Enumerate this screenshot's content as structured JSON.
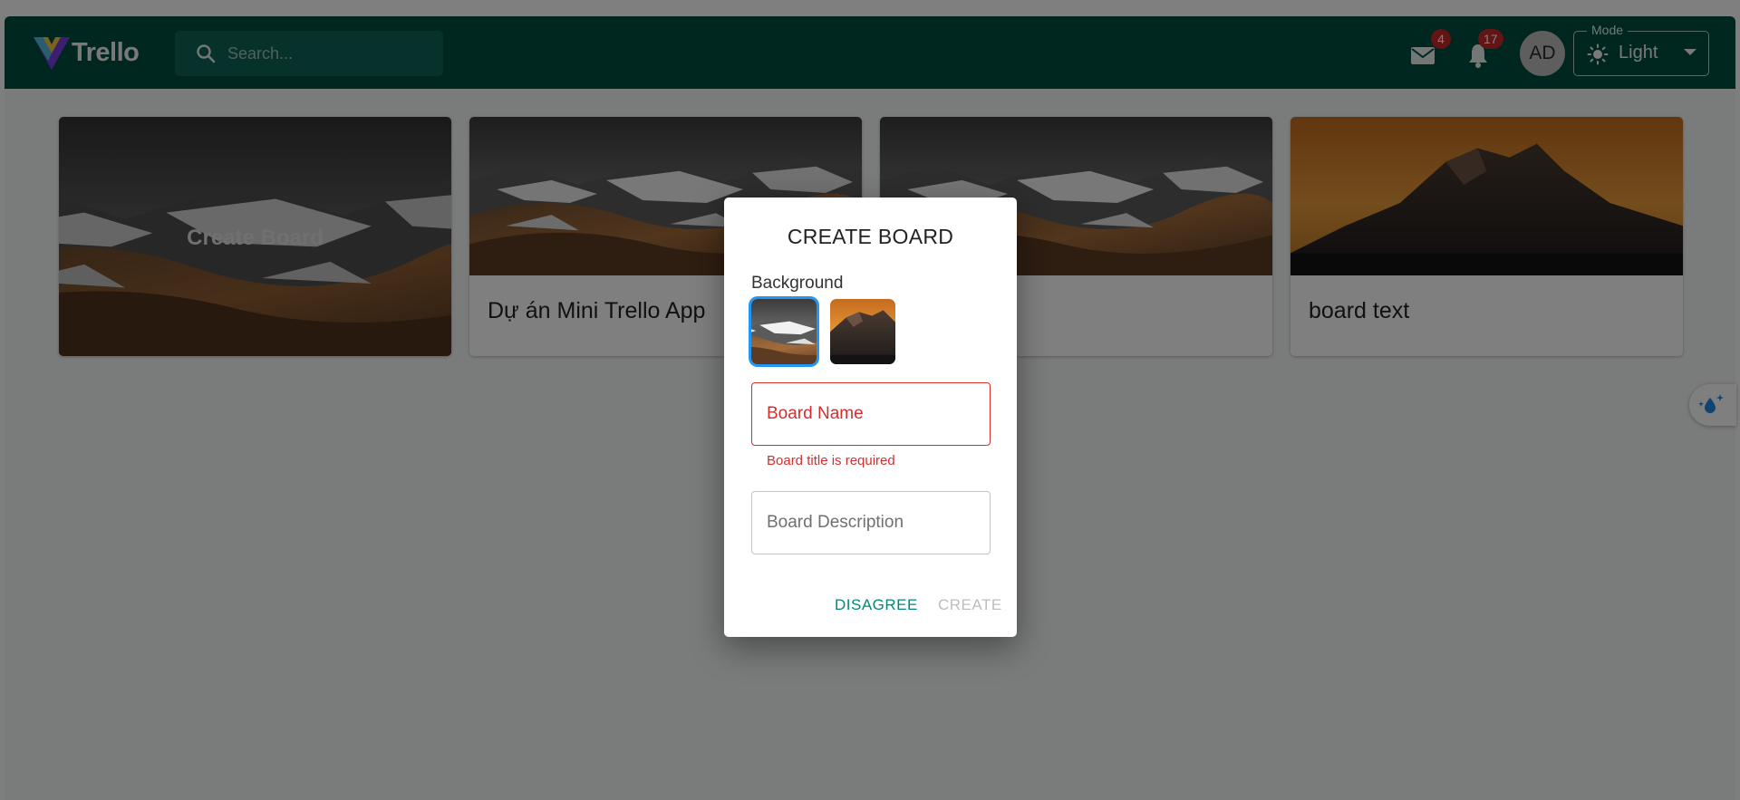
{
  "header": {
    "logo_text": "Trello",
    "search_placeholder": "Search...",
    "mail_count": "4",
    "notification_count": "17",
    "avatar_initials": "AD",
    "mode_label": "Mode",
    "mode_value": "Light"
  },
  "boards": {
    "create_label": "Create Board",
    "items": [
      {
        "title": "Dự án Mini Trello App",
        "cover": "snowy-mountains"
      },
      {
        "title": "",
        "cover": "snowy-mountains"
      },
      {
        "title": "board text",
        "cover": "orange-sunset-mountain"
      }
    ]
  },
  "dialog": {
    "title": "CREATE BOARD",
    "background_label": "Background",
    "backgrounds": [
      "snowy-mountains",
      "orange-sunset-mountain"
    ],
    "board_name_placeholder": "Board Name",
    "board_name_error": "Board title is required",
    "board_description_placeholder": "Board Description",
    "disagree_label": "DISAGREE",
    "create_label": "CREATE"
  },
  "colors": {
    "appbar": "#004d40",
    "accent": "#00897b",
    "error": "#d32f2f",
    "badge": "#c62828",
    "selected_outline": "#2196f3"
  }
}
